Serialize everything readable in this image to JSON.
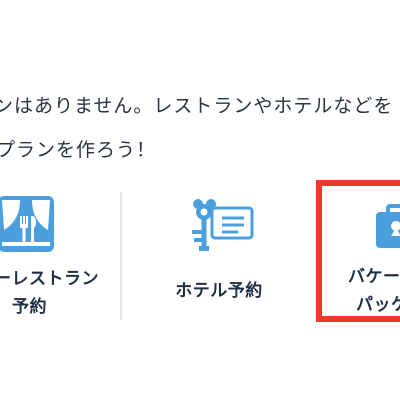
{
  "message": {
    "line1": "ンはありません。レストランやホテルなどを",
    "line2": "プランを作ろう！"
  },
  "options": [
    {
      "id": "restaurant",
      "icon": "restaurant-icon",
      "label_line1": "ーレストラン",
      "label_line2": "予約"
    },
    {
      "id": "hotel",
      "icon": "hotel-key-icon",
      "label_line1": "ホテル予約"
    },
    {
      "id": "vacation-package",
      "icon": "suitcase-icon",
      "label_line1": "バケー",
      "label_line2": "パッケ"
    }
  ],
  "colors": {
    "icon_blue": "#4a9fdc",
    "text_dark": "#1f2f44",
    "highlight_red": "#e63b2e",
    "divider": "#e6e8ec"
  }
}
